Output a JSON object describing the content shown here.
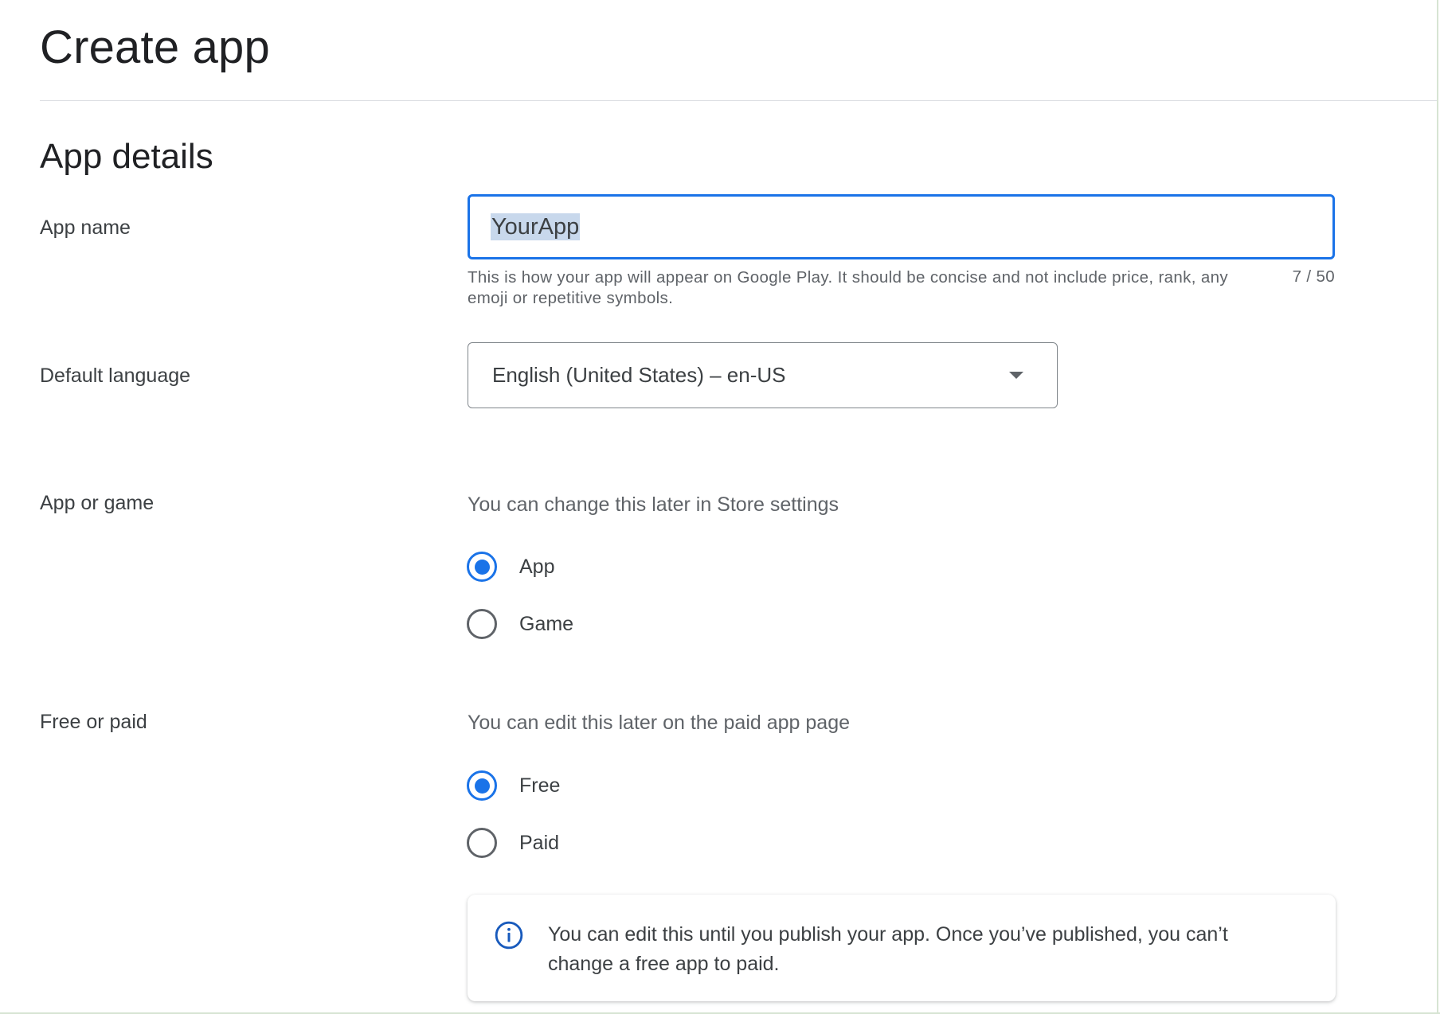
{
  "page": {
    "title": "Create app"
  },
  "section": {
    "title": "App details"
  },
  "app_name": {
    "label": "App name",
    "value": "YourApp",
    "helper": "This is how your app will appear on Google Play. It should be concise and not include price, rank, any emoji or repetitive symbols.",
    "counter": "7 / 50"
  },
  "default_language": {
    "label": "Default language",
    "selected": "English (United States) – en-US"
  },
  "app_or_game": {
    "label": "App or game",
    "hint": "You can change this later in Store settings",
    "options": [
      {
        "label": "App",
        "checked": true
      },
      {
        "label": "Game",
        "checked": false
      }
    ]
  },
  "free_or_paid": {
    "label": "Free or paid",
    "hint": "You can edit this later on the paid app page",
    "options": [
      {
        "label": "Free",
        "checked": true
      },
      {
        "label": "Paid",
        "checked": false
      }
    ],
    "info": "You can edit this until you publish your app. Once you’ve published, you can’t change a free app to paid."
  },
  "colors": {
    "accent": "#1a73e8",
    "info_icon": "#185abc"
  },
  "icons": {
    "language_dropdown": "arrow-drop-down-icon",
    "info": "info-icon"
  }
}
